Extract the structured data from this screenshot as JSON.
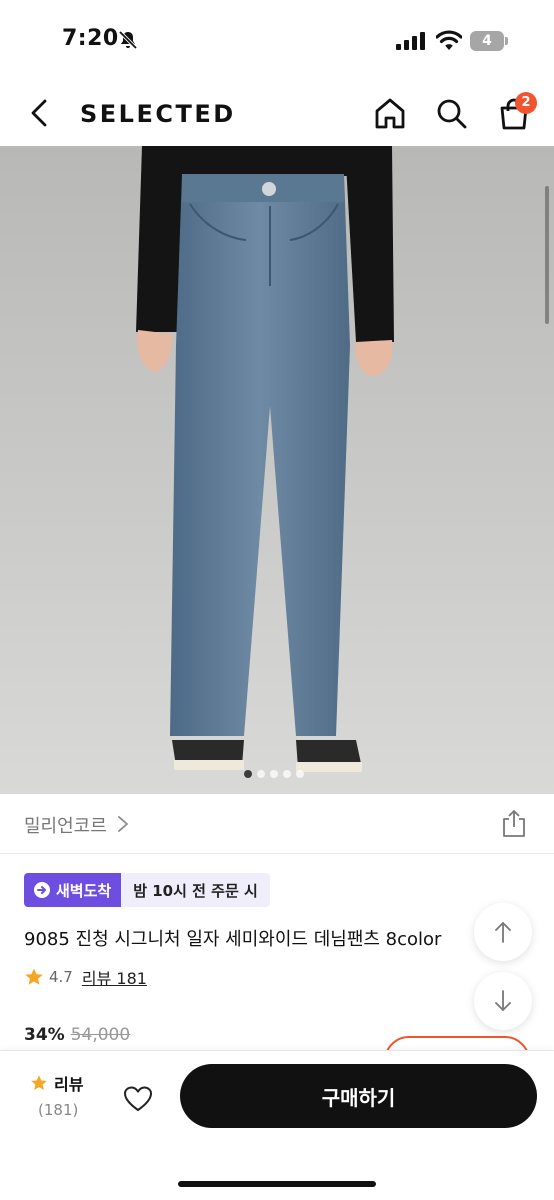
{
  "status_bar": {
    "time": "7:20",
    "battery_level": "4"
  },
  "header": {
    "brand": "SELECTED",
    "cart_count": "2"
  },
  "gallery": {
    "image_count": 5,
    "active_index": 0
  },
  "seller": {
    "name": "밀리언코르"
  },
  "tags": {
    "dawn_delivery": "새벽도착",
    "deadline": "밤 10시 전 주문 시"
  },
  "product": {
    "title": "9085 진청 시그니처 일자 세미와이드 데님팬츠 8color",
    "rating": "4.7",
    "review_link": "리뷰 181",
    "discount_rate": "34%",
    "original_price": "54,000"
  },
  "bottom_bar": {
    "review_label": "리뷰",
    "review_count": "(181)",
    "buy_label": "구매하기"
  },
  "colors": {
    "accent_orange": "#f0552f",
    "dawn_purple": "#6e4ee0",
    "dawn_bg": "#f1eefc",
    "star_orange": "#f5a623",
    "buy_button": "#111111"
  }
}
